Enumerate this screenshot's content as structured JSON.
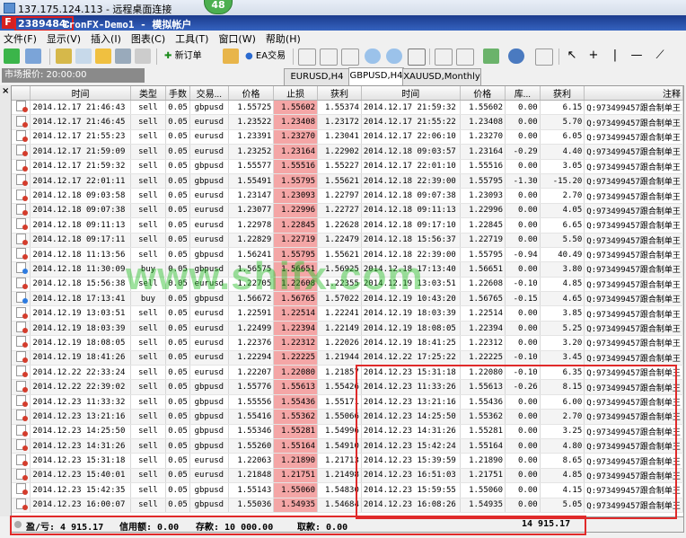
{
  "remote": {
    "title": "137.175.124.113 - 远程桌面连接",
    "pill": "48"
  },
  "window": {
    "app_icon": "F",
    "account": "2389484:",
    "title": "IronFX-Demo1 - 模拟帐户"
  },
  "menu": [
    "文件(F)",
    "显示(V)",
    "插入(I)",
    "图表(C)",
    "工具(T)",
    "窗口(W)",
    "帮助(H)"
  ],
  "toolbar": {
    "new_order": "新订单",
    "ea": "EA交易"
  },
  "market_watch": {
    "label": "市场报价: 20:00:00"
  },
  "tabs": [
    "EURUSD,H4",
    "GBPUSD,H4",
    "XAUUSD,Monthly"
  ],
  "columns": [
    "",
    "时间",
    "类型",
    "手数",
    "交易...",
    "价格",
    "止损",
    "获利",
    "时间",
    "价格",
    "库...",
    "获利",
    "注释"
  ],
  "rows": [
    [
      "2014.12.17 21:46:43",
      "sell",
      "0.05",
      "gbpusd",
      "1.55725",
      "1.55602",
      "1.55374",
      "2014.12.17 21:59:32",
      "1.55602",
      "0.00",
      "6.15",
      "Q:973499457跟合制单王"
    ],
    [
      "2014.12.17 21:46:45",
      "sell",
      "0.05",
      "eurusd",
      "1.23522",
      "1.23408",
      "1.23172",
      "2014.12.17 21:55:22",
      "1.23408",
      "0.00",
      "5.70",
      "Q:973499457跟合制单王"
    ],
    [
      "2014.12.17 21:55:23",
      "sell",
      "0.05",
      "eurusd",
      "1.23391",
      "1.23270",
      "1.23041",
      "2014.12.17 22:06:10",
      "1.23270",
      "0.00",
      "6.05",
      "Q:973499457跟合制单王"
    ],
    [
      "2014.12.17 21:59:09",
      "sell",
      "0.05",
      "eurusd",
      "1.23252",
      "1.23164",
      "1.22902",
      "2014.12.18 09:03:57",
      "1.23164",
      "-0.29",
      "4.40",
      "Q:973499457跟合制单王"
    ],
    [
      "2014.12.17 21:59:32",
      "sell",
      "0.05",
      "gbpusd",
      "1.55577",
      "1.55516",
      "1.55227",
      "2014.12.17 22:01:10",
      "1.55516",
      "0.00",
      "3.05",
      "Q:973499457跟合制单王"
    ],
    [
      "2014.12.17 22:01:11",
      "sell",
      "0.05",
      "gbpusd",
      "1.55491",
      "1.55795",
      "1.55621",
      "2014.12.18 22:39:00",
      "1.55795",
      "-1.30",
      "-15.20",
      "Q:973499457跟合制单王"
    ],
    [
      "2014.12.18 09:03:58",
      "sell",
      "0.05",
      "eurusd",
      "1.23147",
      "1.23093",
      "1.22797",
      "2014.12.18 09:07:38",
      "1.23093",
      "0.00",
      "2.70",
      "Q:973499457跟合制单王"
    ],
    [
      "2014.12.18 09:07:38",
      "sell",
      "0.05",
      "eurusd",
      "1.23077",
      "1.22996",
      "1.22727",
      "2014.12.18 09:11:13",
      "1.22996",
      "0.00",
      "4.05",
      "Q:973499457跟合制单王"
    ],
    [
      "2014.12.18 09:11:13",
      "sell",
      "0.05",
      "eurusd",
      "1.22978",
      "1.22845",
      "1.22628",
      "2014.12.18 09:17:10",
      "1.22845",
      "0.00",
      "6.65",
      "Q:973499457跟合制单王"
    ],
    [
      "2014.12.18 09:17:11",
      "sell",
      "0.05",
      "eurusd",
      "1.22829",
      "1.22719",
      "1.22479",
      "2014.12.18 15:56:37",
      "1.22719",
      "0.00",
      "5.50",
      "Q:973499457跟合制单王"
    ],
    [
      "2014.12.18 11:13:56",
      "sell",
      "0.05",
      "gbpusd",
      "1.56241",
      "1.55795",
      "1.55621",
      "2014.12.18 22:39:00",
      "1.55795",
      "-0.94",
      "40.49",
      "Q:973499457跟合制单王"
    ],
    [
      "2014.12.18 11:30:09",
      "buy",
      "0.05",
      "gbpusd",
      "1.56575",
      "1.56651",
      "1.56925",
      "2014.12.18 17:13:40",
      "1.56651",
      "0.00",
      "3.80",
      "Q:973499457跟合制单王"
    ],
    [
      "2014.12.18 15:56:38",
      "sell",
      "0.05",
      "eurusd",
      "1.22705",
      "1.22608",
      "1.22355",
      "2014.12.19 13:03:51",
      "1.22608",
      "-0.10",
      "4.85",
      "Q:973499457跟合制单王"
    ],
    [
      "2014.12.18 17:13:41",
      "buy",
      "0.05",
      "gbpusd",
      "1.56672",
      "1.56765",
      "1.57022",
      "2014.12.19 10:43:20",
      "1.56765",
      "-0.15",
      "4.65",
      "Q:973499457跟合制单王"
    ],
    [
      "2014.12.19 13:03:51",
      "sell",
      "0.05",
      "eurusd",
      "1.22591",
      "1.22514",
      "1.22241",
      "2014.12.19 18:03:39",
      "1.22514",
      "0.00",
      "3.85",
      "Q:973499457跟合制单王"
    ],
    [
      "2014.12.19 18:03:39",
      "sell",
      "0.05",
      "eurusd",
      "1.22499",
      "1.22394",
      "1.22149",
      "2014.12.19 18:08:05",
      "1.22394",
      "0.00",
      "5.25",
      "Q:973499457跟合制单王"
    ],
    [
      "2014.12.19 18:08:05",
      "sell",
      "0.05",
      "eurusd",
      "1.22376",
      "1.22312",
      "1.22026",
      "2014.12.19 18:41:25",
      "1.22312",
      "0.00",
      "3.20",
      "Q:973499457跟合制单王"
    ],
    [
      "2014.12.19 18:41:26",
      "sell",
      "0.05",
      "eurusd",
      "1.22294",
      "1.22225",
      "1.21944",
      "2014.12.22 17:25:22",
      "1.22225",
      "-0.10",
      "3.45",
      "Q:973499457跟合制单王"
    ],
    [
      "2014.12.22 22:33:24",
      "sell",
      "0.05",
      "eurusd",
      "1.22207",
      "1.22080",
      "1.21857",
      "2014.12.23 15:31:18",
      "1.22080",
      "-0.10",
      "6.35",
      "Q:973499457跟合制单王"
    ],
    [
      "2014.12.22 22:39:02",
      "sell",
      "0.05",
      "gbpusd",
      "1.55776",
      "1.55613",
      "1.55426",
      "2014.12.23 11:33:26",
      "1.55613",
      "-0.26",
      "8.15",
      "Q:973499457跟合制单王"
    ],
    [
      "2014.12.23 11:33:32",
      "sell",
      "0.05",
      "gbpusd",
      "1.55556",
      "1.55436",
      "1.55171",
      "2014.12.23 13:21:16",
      "1.55436",
      "0.00",
      "6.00",
      "Q:973499457跟合制单王"
    ],
    [
      "2014.12.23 13:21:16",
      "sell",
      "0.05",
      "gbpusd",
      "1.55416",
      "1.55362",
      "1.55066",
      "2014.12.23 14:25:50",
      "1.55362",
      "0.00",
      "2.70",
      "Q:973499457跟合制单王"
    ],
    [
      "2014.12.23 14:25:50",
      "sell",
      "0.05",
      "gbpusd",
      "1.55346",
      "1.55281",
      "1.54996",
      "2014.12.23 14:31:26",
      "1.55281",
      "0.00",
      "3.25",
      "Q:973499457跟合制单王"
    ],
    [
      "2014.12.23 14:31:26",
      "sell",
      "0.05",
      "gbpusd",
      "1.55260",
      "1.55164",
      "1.54910",
      "2014.12.23 15:42:24",
      "1.55164",
      "0.00",
      "4.80",
      "Q:973499457跟合制单王"
    ],
    [
      "2014.12.23 15:31:18",
      "sell",
      "0.05",
      "eurusd",
      "1.22063",
      "1.21890",
      "1.21713",
      "2014.12.23 15:39:59",
      "1.21890",
      "0.00",
      "8.65",
      "Q:973499457跟合制单王"
    ],
    [
      "2014.12.23 15:40:01",
      "sell",
      "0.05",
      "eurusd",
      "1.21848",
      "1.21751",
      "1.21498",
      "2014.12.23 16:51:03",
      "1.21751",
      "0.00",
      "4.85",
      "Q:973499457跟合制单王"
    ],
    [
      "2014.12.23 15:42:35",
      "sell",
      "0.05",
      "gbpusd",
      "1.55143",
      "1.55060",
      "1.54830",
      "2014.12.23 15:59:55",
      "1.55060",
      "0.00",
      "4.15",
      "Q:973499457跟合制单王"
    ],
    [
      "2014.12.23 16:00:07",
      "sell",
      "0.05",
      "gbpusd",
      "1.55036",
      "1.54935",
      "1.54684",
      "2014.12.23 16:08:26",
      "1.54935",
      "0.00",
      "5.05",
      "Q:973499457跟合制单王"
    ]
  ],
  "status": {
    "profit_label": "盈/亏: 4 915.17",
    "credit_label": "信用额: 0.00",
    "deposit_label": "存款: 10 000.00",
    "withdraw_label": "取款: 0.00",
    "balance": "14 915.17"
  },
  "watermark": "www.shifx.com"
}
